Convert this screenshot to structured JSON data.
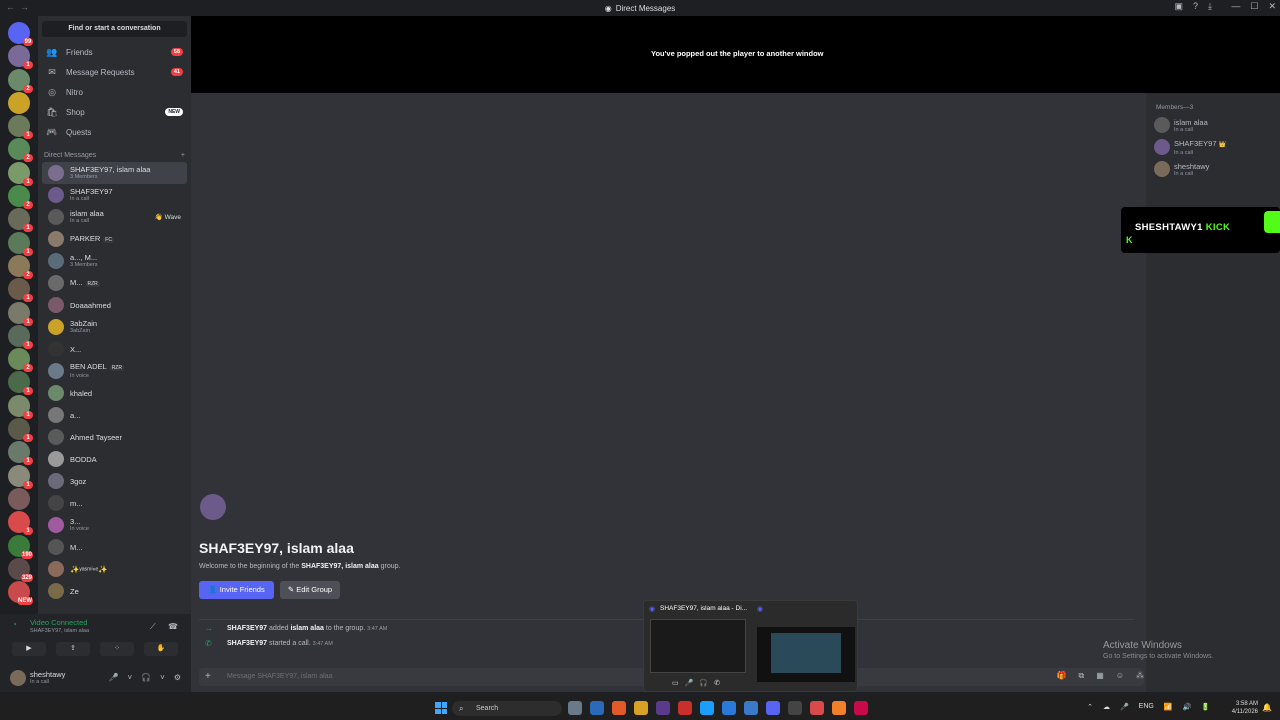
{
  "window": {
    "title": "Direct Messages",
    "controls": [
      "—",
      "☐",
      "✕"
    ],
    "tools": [
      "▣",
      "?",
      "⤓"
    ]
  },
  "sidebar": {
    "search": "Find or start a conversation",
    "nav": [
      {
        "label": "Friends",
        "icon": "👥",
        "count": "58"
      },
      {
        "label": "Message Requests",
        "icon": "✉",
        "count": "41"
      },
      {
        "label": "Nitro",
        "icon": "◎"
      },
      {
        "label": "Shop",
        "icon": "🛍",
        "new": "NEW"
      },
      {
        "label": "Quests",
        "icon": "🎮"
      }
    ],
    "dm_header": "Direct Messages",
    "dm_add": "+",
    "dms": [
      {
        "name": "SHAF3EY97, islam alaa",
        "sub": "3 Members",
        "color": "#7b6d8d",
        "active": true
      },
      {
        "name": "SHAF3EY97",
        "sub": "In a call",
        "color": "#6b5a8a"
      },
      {
        "name": "islam alaa",
        "sub": "In a call",
        "color": "#5a5a5a",
        "wave": "👋 Wave"
      },
      {
        "name": "PARKER",
        "tag": "FC",
        "color": "#8a7a6a"
      },
      {
        "name": "a..., M...",
        "sub": "3 Members",
        "color": "#5a6b7a"
      },
      {
        "name": "M...",
        "tag": "RZR",
        "color": "#6a6a6a"
      },
      {
        "name": "Doaaahmed",
        "color": "#7a5a6a"
      },
      {
        "name": "3abZain",
        "sub": "3abZain",
        "color": "#c9a227"
      },
      {
        "name": "X...",
        "color": "#333"
      },
      {
        "name": "BEN ADEL",
        "sub": "In voice",
        "tag": "RZR",
        "color": "#6a7a8a"
      },
      {
        "name": "khaled",
        "color": "#6a8a6a"
      },
      {
        "name": "a...",
        "color": "#777"
      },
      {
        "name": "Ahmed Tayseer",
        "color": "#5a5a5a"
      },
      {
        "name": "BODDA",
        "color": "#9a9a9a"
      },
      {
        "name": "3goz",
        "color": "#6a6a7a"
      },
      {
        "name": "m...",
        "color": "#444"
      },
      {
        "name": "3...",
        "sub": "In voice",
        "color": "#a05aa0"
      },
      {
        "name": "M...",
        "color": "#555"
      },
      {
        "name": "✨ʸᵃˢᵐⁱⁿᵉ✨",
        "color": "#8a6a5a"
      },
      {
        "name": "Ze",
        "color": "#7a6a4a"
      }
    ]
  },
  "voice": {
    "status": "Video Connected",
    "channel": "SHAF3EY97, islam alaa",
    "buttons": [
      "▶",
      "⇪",
      "⁘",
      "✋"
    ]
  },
  "user": {
    "name": "sheshtawy",
    "status": "In a call",
    "controls": [
      "🎤",
      "˅",
      "🎧",
      "˅",
      "⚙"
    ]
  },
  "popout": {
    "text": "You've popped out the player to another window"
  },
  "members": {
    "header": "Members—3",
    "list": [
      {
        "name": "islam alaa",
        "sub": "In a call",
        "color": "#5a5a5a"
      },
      {
        "name": "SHAF3EY97",
        "crown": "👑",
        "sub": "In a call",
        "color": "#6b5a8a"
      },
      {
        "name": "sheshtawy",
        "sub": "In a call",
        "color": "#7a6a5a"
      }
    ]
  },
  "kick": {
    "name": "SHESHTAWY1",
    "brand": "KICK"
  },
  "welcome": {
    "title": "SHAF3EY97, islam alaa",
    "sub_pre": "Welcome to the beginning of the",
    "sub_bold": "SHAF3EY97, islam alaa",
    "sub_post": "group.",
    "invite": "Invite Friends",
    "edit": "Edit Group"
  },
  "messages": [
    {
      "icon": "→",
      "user": "SHAF3EY97",
      "text": "added",
      "target": "islam alaa",
      "text2": "to the group.",
      "time": "3:47 AM"
    },
    {
      "icon": "✆",
      "user": "SHAF3EY97",
      "text": "started a call.",
      "target": "",
      "text2": "",
      "time": "3:47 AM"
    }
  ],
  "input": {
    "placeholder": "Message SHAF3EY97, islam alaa",
    "plus": "+",
    "tools": [
      "🎁",
      "⧉",
      "▦",
      "☺",
      "⁂"
    ]
  },
  "activate": {
    "line1": "Activate Windows",
    "line2": "Go to Settings to activate Windows."
  },
  "preview": {
    "title": "SHAF3EY97, islam alaa - Di...",
    "ctrls": [
      "▭",
      "🎤",
      "🎧",
      "✆"
    ]
  },
  "taskbar": {
    "search": "Search",
    "tray": [
      "⌃",
      "☁",
      "🎤",
      "ENG",
      "📶",
      "🔊",
      "🔋"
    ],
    "time": "3:58 AM",
    "date": "4/11/2026"
  },
  "colors": {
    "blurple": "#5865f2",
    "green": "#23a55a",
    "red": "#f23f43",
    "kick": "#53fc18"
  }
}
